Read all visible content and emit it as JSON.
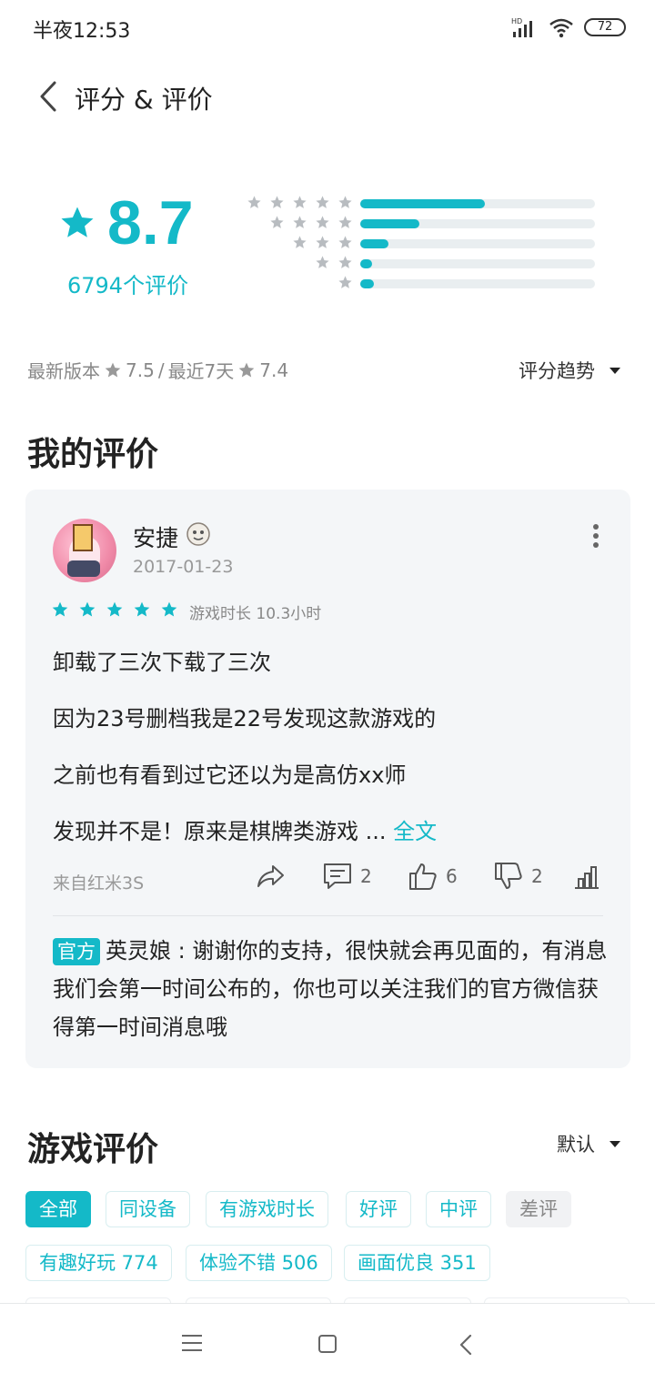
{
  "status_bar": {
    "time": "半夜12:53",
    "battery": "72",
    "network": "HD"
  },
  "header": {
    "title": "评分 & 评价"
  },
  "rating": {
    "score": "8.7",
    "count_label": "6794个评价",
    "distribution": [
      {
        "stars": 5,
        "fraction": 0.53
      },
      {
        "stars": 4,
        "fraction": 0.25
      },
      {
        "stars": 3,
        "fraction": 0.12
      },
      {
        "stars": 2,
        "fraction": 0.05
      },
      {
        "stars": 1,
        "fraction": 0.06
      }
    ]
  },
  "version": {
    "latest_label": "最新版本",
    "latest_score": "7.5",
    "separator": "/",
    "recent_label": "最近7天",
    "recent_score": "7.4",
    "trend_label": "评分趋势"
  },
  "my_review": {
    "section_title": "我的评价",
    "user_name": "安捷",
    "date": "2017-01-23",
    "stars": 5,
    "play_time": "游戏时长 10.3小时",
    "lines": [
      "卸载了三次下载了三次",
      "因为23号删档我是22号发现这款游戏的",
      "之前也有看到过它还以为是高仿xx师",
      "发现并不是！原来是棋牌类游戏 ..."
    ],
    "full_text_link": "全文",
    "device": "来自红米3S",
    "comment_count": "2",
    "like_count": "6",
    "dislike_count": "2",
    "reply": {
      "tag": "官方",
      "author": "英灵娘",
      "separator": " : ",
      "text": "谢谢你的支持，很快就会再见面的，有消息我们会第一时间公布的，你也可以关注我们的官方微信获得第一时间消息哦"
    }
  },
  "game_reviews": {
    "section_title": "游戏评价",
    "sort_label": "默认",
    "filters_row1": [
      "全部",
      "同设备",
      "有游戏时长",
      "好评",
      "中评",
      "差评"
    ],
    "filters_row2": [
      "有趣好玩 774",
      "体验不错 506",
      "画面优良 351"
    ]
  },
  "colors": {
    "accent": "#14b9c8",
    "text": "#222222",
    "muted": "#888888"
  }
}
